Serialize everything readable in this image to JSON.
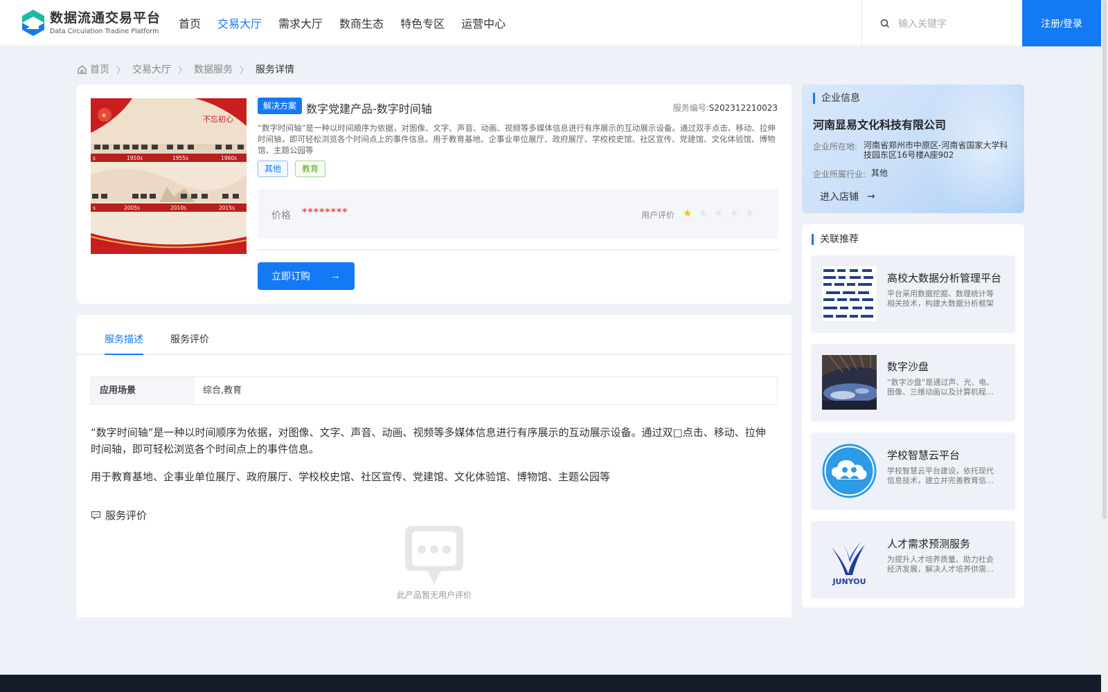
{
  "brand": {
    "name_cn": "数据流通交易平台",
    "name_en": "Data Circulation Tradine Platform"
  },
  "nav": [
    {
      "label": "首页",
      "active": false
    },
    {
      "label": "交易大厅",
      "active": true
    },
    {
      "label": "需求大厅",
      "active": false
    },
    {
      "label": "数商生态",
      "active": false
    },
    {
      "label": "特色专区",
      "active": false
    },
    {
      "label": "运营中心",
      "active": false
    }
  ],
  "search": {
    "placeholder": "输入关键字",
    "value": ""
  },
  "login_label": "注册/登录",
  "breadcrumb": [
    "首页",
    "交易大厅",
    "数据服务",
    "服务详情"
  ],
  "product": {
    "badge": "解决方案",
    "title": "数字党建产品-数字时间轴",
    "service_no_label": "服务编号:",
    "service_no": "S202312210023",
    "description": "“数字时间轴”是一种以时间顺序为依据，对图像、文字、声音、动画、视频等多媒体信息进行有序展示的互动展示设备。通过双手点击、移动、拉伸时间轴，即可轻松浏览各个时间点上的事件信息。用于教育基地、企事业单位展厅、政府展厅、学校校史馆、社区宣传、党建馆、文化体验馆、博物馆、主题公园等",
    "tags": [
      "其他",
      "教育"
    ],
    "price_label": "价格",
    "price_value": "********",
    "rating_label": "用户评价",
    "rating": 1,
    "rating_max": 5,
    "order_label": "立即订购",
    "image": {
      "slogan": "不忘初心",
      "decades_top": [
        "s",
        "1950s",
        "1955s",
        "1960s"
      ],
      "decades_bottom": [
        "s",
        "2005s",
        "2010s",
        "2015s"
      ]
    }
  },
  "tabs": [
    {
      "label": "服务描述",
      "active": true
    },
    {
      "label": "服务评价",
      "active": false
    }
  ],
  "scene": {
    "label": "应用场景",
    "value": "综合,教育"
  },
  "body": {
    "para1": "“数字时间轴”是一种以时间顺序为依据，对图像、文字、声音、动画、视频等多媒体信息进行有序展示的互动展示设备。通过双□点击、移动、拉伸时间轴，即可轻松浏览各个时间点上的事件信息。",
    "para2": "用于教育基地、企事业单位展厅、政府展厅、学校校史馆、社区宣传、党建馆、文化体验馆、博物馆、主题公园等"
  },
  "evaluation": {
    "heading": "服务评价",
    "empty_text": "此产品暂无用户评价"
  },
  "company": {
    "section_title": "企业信息",
    "name": "河南显易文化科技有限公司",
    "location_label": "企业所在地:",
    "location": "河南省郑州市中原区-河南省国家大学科技园东区16号楼A座902",
    "industry_label": "企业所属行业:",
    "industry": "其他",
    "shop_label": "进入店铺"
  },
  "recommend": {
    "section_title": "关联推荐",
    "items": [
      {
        "name": "高校大数据分析管理平台",
        "desc": "平台采用数据挖掘、数理统计等相关技术，构建大数据分析框架",
        "icon": "diagram-thumbnail"
      },
      {
        "name": "数字沙盘",
        "desc": "“数字沙盘”是通过声、光、电、图像、三维动画以及计算机程控技术",
        "icon": "sandbox-photo"
      },
      {
        "name": "学校智慧云平台",
        "desc": "学校智慧云平台建设，依托现代信息技术，建立并完善教育信息化",
        "icon": "cloud-people-logo"
      },
      {
        "name": "人才需求预测服务",
        "desc": "为提升人才培养质量、助力社会经济发展，解决人才培养供需问题",
        "icon": "junyou-logo",
        "logo_text": "JUNYOU"
      }
    ]
  },
  "colors": {
    "primary": "#1479f4",
    "price": "#f04a4a",
    "star": "#fbb928",
    "page_bg": "#eef1f7",
    "footer": "#151c2c"
  }
}
